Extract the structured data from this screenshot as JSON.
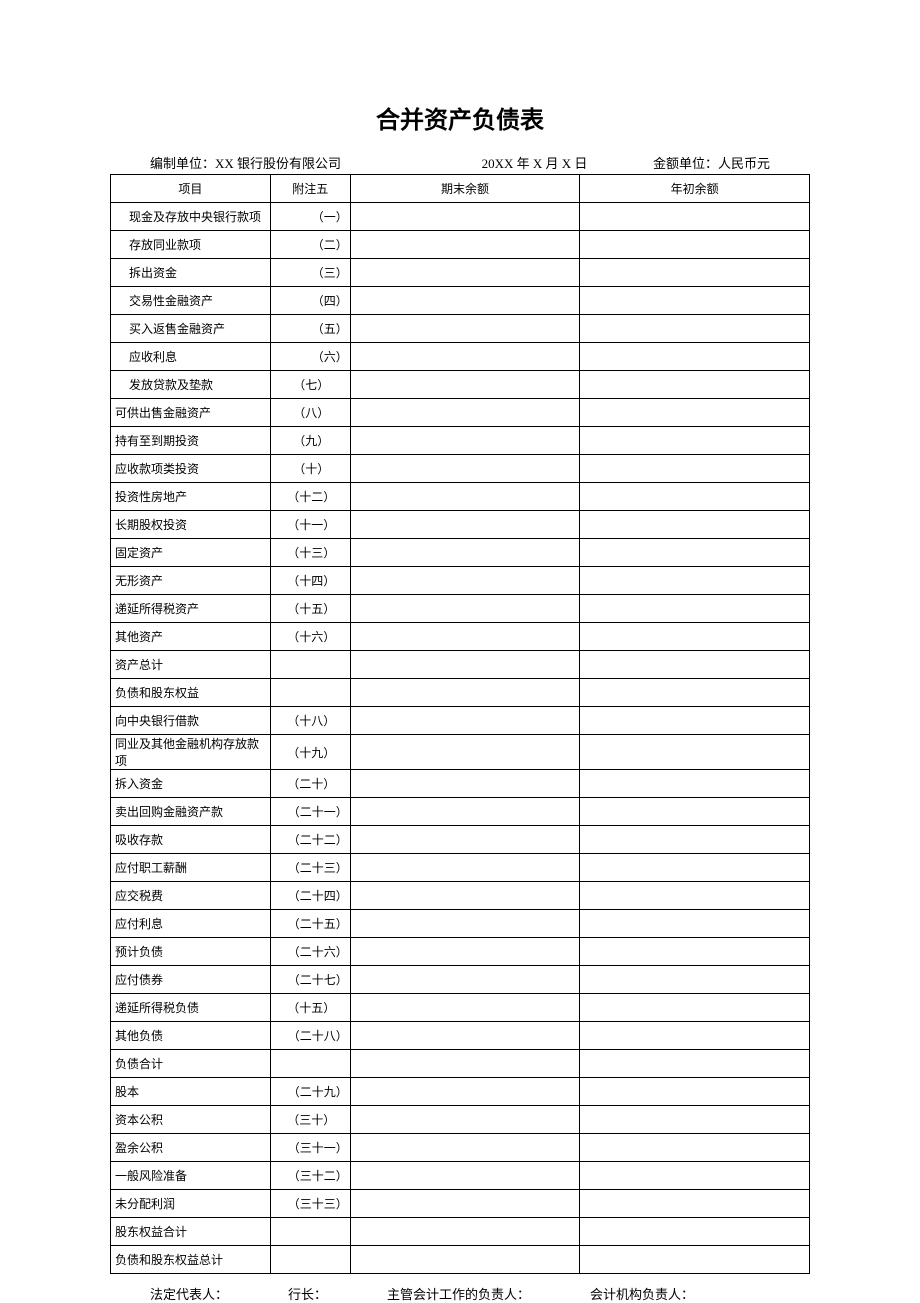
{
  "title": "合并资产负债表",
  "meta": {
    "org": "编制单位：XX 银行股份有限公司",
    "date": "20XX 年 X 月 X 日",
    "unit": "金额单位：人民币元"
  },
  "columns": {
    "item": "项目",
    "note": "附注五",
    "end": "期末余额",
    "begin": "年初余额"
  },
  "rows": [
    {
      "item": "现金及存放中央银行款项",
      "note": "（一）",
      "indent": true,
      "noteAlign": "right"
    },
    {
      "item": "存放同业款项",
      "note": "（二）",
      "indent": true,
      "noteAlign": "right"
    },
    {
      "item": "拆出资金",
      "note": "（三）",
      "indent": true,
      "noteAlign": "right"
    },
    {
      "item": "交易性金融资产",
      "note": "（四）",
      "indent": true,
      "noteAlign": "right"
    },
    {
      "item": "买入返售金融资产",
      "note": "（五）",
      "indent": true,
      "noteAlign": "right"
    },
    {
      "item": "应收利息",
      "note": "（六）",
      "indent": true,
      "noteAlign": "right"
    },
    {
      "item": "发放贷款及垫款",
      "note": "（七）",
      "indent": true,
      "noteAlign": "center"
    },
    {
      "item": "可供出售金融资产",
      "note": "（八）",
      "indent": false,
      "noteAlign": "center"
    },
    {
      "item": "持有至到期投资",
      "note": "（九）",
      "indent": false,
      "noteAlign": "center"
    },
    {
      "item": "应收款项类投资",
      "note": "（十）",
      "indent": false,
      "noteAlign": "center"
    },
    {
      "item": "投资性房地产",
      "note": "（十二）",
      "indent": false,
      "noteAlign": "center"
    },
    {
      "item": "长期股权投资",
      "note": "（十一）",
      "indent": false,
      "noteAlign": "center"
    },
    {
      "item": "固定资产",
      "note": "（十三）",
      "indent": false,
      "noteAlign": "center"
    },
    {
      "item": "无形资产",
      "note": "（十四）",
      "indent": false,
      "noteAlign": "center"
    },
    {
      "item": "递延所得税资产",
      "note": "（十五）",
      "indent": false,
      "noteAlign": "center"
    },
    {
      "item": "其他资产",
      "note": "（十六）",
      "indent": false,
      "noteAlign": "center"
    },
    {
      "item": "资产总计",
      "note": "",
      "indent": false,
      "noteAlign": "center"
    },
    {
      "item": "负债和股东权益",
      "note": "",
      "indent": false,
      "noteAlign": "center"
    },
    {
      "item": "向中央银行借款",
      "note": "（十八）",
      "indent": false,
      "noteAlign": "center"
    },
    {
      "item": "同业及其他金融机构存放款项",
      "note": "（十九）",
      "indent": false,
      "noteAlign": "center"
    },
    {
      "item": "拆入资金",
      "note": "（二十）",
      "indent": false,
      "noteAlign": "center"
    },
    {
      "item": "卖出回购金融资产款",
      "note": "（二十一）",
      "indent": false,
      "noteAlign": "right"
    },
    {
      "item": "吸收存款",
      "note": "（二十二）",
      "indent": false,
      "noteAlign": "right"
    },
    {
      "item": "应付职工薪酬",
      "note": "（二十三）",
      "indent": false,
      "noteAlign": "right"
    },
    {
      "item": "应交税费",
      "note": "（二十四）",
      "indent": false,
      "noteAlign": "right"
    },
    {
      "item": "应付利息",
      "note": "（二十五）",
      "indent": false,
      "noteAlign": "right"
    },
    {
      "item": "预计负债",
      "note": "（二十六）",
      "indent": false,
      "noteAlign": "right"
    },
    {
      "item": "应付债券",
      "note": "（二十七）",
      "indent": false,
      "noteAlign": "right"
    },
    {
      "item": "递延所得税负债",
      "note": "（十五）",
      "indent": false,
      "noteAlign": "center"
    },
    {
      "item": "其他负债",
      "note": "（二十八）",
      "indent": false,
      "noteAlign": "right"
    },
    {
      "item": "负债合计",
      "note": "",
      "indent": false,
      "noteAlign": "center"
    },
    {
      "item": "股本",
      "note": "（二十九）",
      "indent": false,
      "noteAlign": "right"
    },
    {
      "item": "资本公积",
      "note": "（三十）",
      "indent": false,
      "noteAlign": "center"
    },
    {
      "item": "盈余公积",
      "note": "（三十一）",
      "indent": false,
      "noteAlign": "right"
    },
    {
      "item": "一般风险准备",
      "note": "（三十二）",
      "indent": false,
      "noteAlign": "right"
    },
    {
      "item": "未分配利润",
      "note": "（三十三）",
      "indent": false,
      "noteAlign": "right"
    },
    {
      "item": "股东权益合计",
      "note": "",
      "indent": false,
      "noteAlign": "center"
    },
    {
      "item": "负债和股东权益总计",
      "note": "",
      "indent": false,
      "noteAlign": "center"
    }
  ],
  "footer": {
    "legal": "法定代表人：",
    "president": "行长：",
    "accountHead": "主管会计工作的负责人：",
    "accountOrg": "会计机构负责人："
  }
}
